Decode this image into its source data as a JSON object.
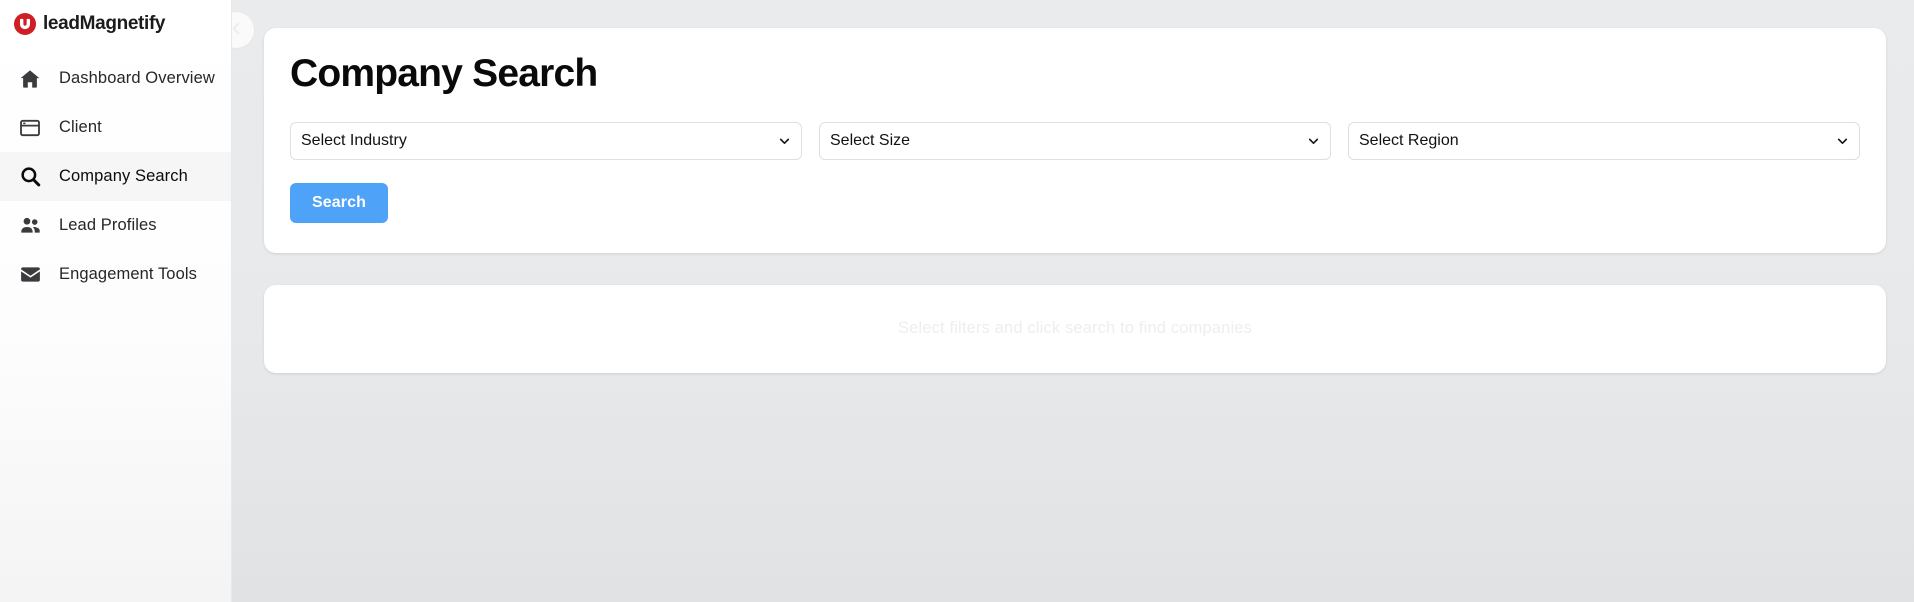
{
  "brand": {
    "name": "leadMagnetify",
    "logo_icon": "magnet-circle-icon",
    "logo_color": "#cf1f26"
  },
  "sidebar": {
    "items": [
      {
        "label": "Dashboard Overview",
        "icon": "home-icon",
        "active": false
      },
      {
        "label": "Client",
        "icon": "browser-window-icon",
        "active": false
      },
      {
        "label": "Company Search",
        "icon": "search-icon",
        "active": true
      },
      {
        "label": "Lead Profiles",
        "icon": "people-icon",
        "active": false
      },
      {
        "label": "Engagement Tools",
        "icon": "envelope-icon",
        "active": false
      }
    ]
  },
  "main": {
    "collapse_button": {
      "icon": "chevron-left-icon",
      "label": "Collapse sidebar"
    },
    "page_title": "Company Search",
    "filters": [
      {
        "name": "industry",
        "selected": "Select Industry",
        "icon": "chevron-down-icon"
      },
      {
        "name": "size",
        "selected": "Select Size",
        "icon": "chevron-down-icon"
      },
      {
        "name": "region",
        "selected": "Select Region",
        "icon": "chevron-down-icon"
      }
    ],
    "search_button": {
      "label": "Search",
      "color": "#4ea2f7"
    },
    "results": {
      "empty_message": "Select filters and click search to find companies"
    }
  }
}
